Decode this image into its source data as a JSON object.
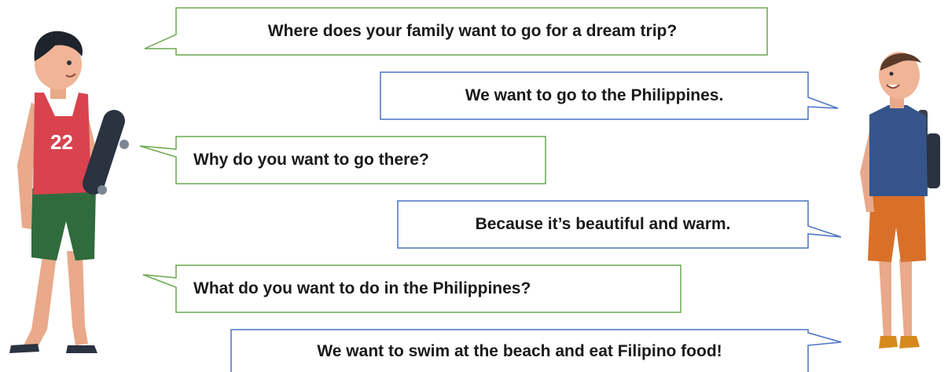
{
  "dialogue": [
    {
      "speaker": "boy-left",
      "text": "Where does your family want to go for a dream trip?"
    },
    {
      "speaker": "boy-right",
      "text": "We want to go to the Philippines."
    },
    {
      "speaker": "boy-left",
      "text": "Why do you want to go there?"
    },
    {
      "speaker": "boy-right",
      "text": "Because it’s beautiful and warm."
    },
    {
      "speaker": "boy-left",
      "text": "What do you want to do in the Philippines?"
    },
    {
      "speaker": "boy-right",
      "text": "We want to swim at the beach and eat Filipino food!"
    }
  ],
  "figures": {
    "left": {
      "shirt_number": "22"
    }
  },
  "colors": {
    "question_border": "#6aa84f",
    "answer_border": "#4a72c4"
  }
}
